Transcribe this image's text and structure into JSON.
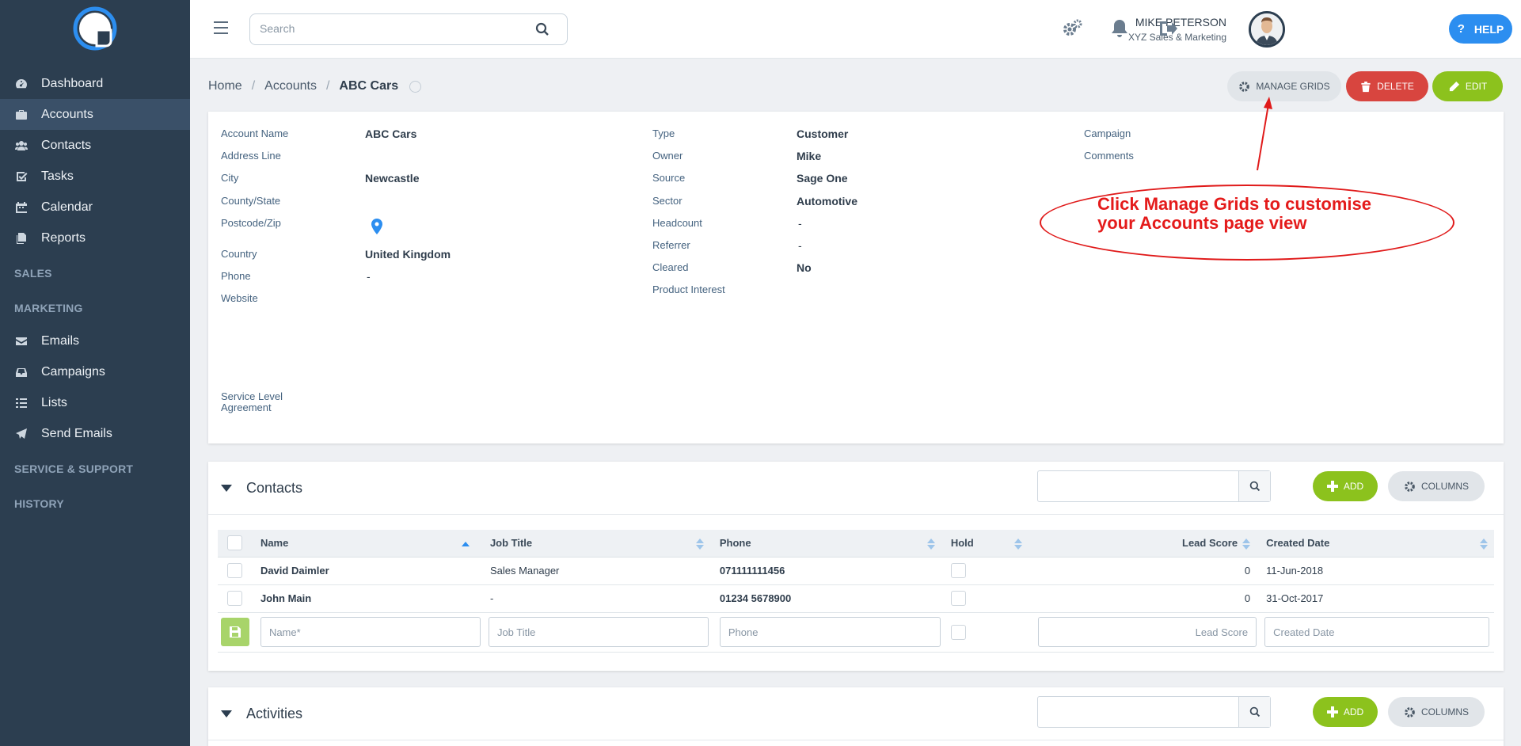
{
  "sidebar": {
    "items": [
      {
        "label": "Dashboard",
        "icon": "dashboard-icon"
      },
      {
        "label": "Accounts",
        "icon": "briefcase-icon",
        "active": true
      },
      {
        "label": "Contacts",
        "icon": "users-icon"
      },
      {
        "label": "Tasks",
        "icon": "check-square-icon"
      },
      {
        "label": "Calendar",
        "icon": "calendar-icon"
      },
      {
        "label": "Reports",
        "icon": "copy-icon"
      }
    ],
    "section_sales": "SALES",
    "section_marketing": "MARKETING",
    "marketing_items": [
      {
        "label": "Emails",
        "icon": "envelope-icon"
      },
      {
        "label": "Campaigns",
        "icon": "inbox-icon"
      },
      {
        "label": "Lists",
        "icon": "list-icon"
      },
      {
        "label": "Send Emails",
        "icon": "paper-plane-icon"
      }
    ],
    "section_service": "SERVICE & SUPPORT",
    "section_history": "HISTORY"
  },
  "header": {
    "search_placeholder": "Search",
    "user_name": "MIKE PETERSON",
    "company": "XYZ Sales & Marketing",
    "help_label": "HELP"
  },
  "breadcrumb": {
    "home": "Home",
    "accounts": "Accounts",
    "current": "ABC Cars"
  },
  "actions": {
    "manage_grids": "MANAGE GRIDS",
    "delete": "DELETE",
    "edit": "EDIT"
  },
  "details": {
    "col1": [
      {
        "label": "Account Name",
        "value": "ABC Cars"
      },
      {
        "label": "Address Line",
        "value": ""
      },
      {
        "label": "City",
        "value": "Newcastle"
      },
      {
        "label": "County/State",
        "value": ""
      },
      {
        "label": "Postcode/Zip",
        "value": ""
      },
      {
        "label": "Country",
        "value": "United Kingdom"
      },
      {
        "label": "Phone",
        "value": "-"
      },
      {
        "label": "Website",
        "value": ""
      }
    ],
    "sla_label": "Service Level Agreement",
    "col2": [
      {
        "label": "Type",
        "value": "Customer"
      },
      {
        "label": "Owner",
        "value": "Mike"
      },
      {
        "label": "Source",
        "value": "Sage One"
      },
      {
        "label": "Sector",
        "value": "Automotive"
      },
      {
        "label": "Headcount",
        "value": "-"
      },
      {
        "label": "Referrer",
        "value": "-"
      },
      {
        "label": "Cleared",
        "value": "No"
      },
      {
        "label": "Product Interest",
        "value": ""
      }
    ],
    "col3": [
      {
        "label": "Campaign",
        "value": ""
      },
      {
        "label": "Comments",
        "value": ""
      }
    ]
  },
  "annotation": {
    "line1": "Click Manage Grids to customise",
    "line2": "your Accounts page view"
  },
  "contacts": {
    "title": "Contacts",
    "add_label": "ADD",
    "columns_label": "COLUMNS",
    "headers": [
      "Name",
      "Job Title",
      "Phone",
      "Hold",
      "Lead Score",
      "Created Date"
    ],
    "rows": [
      {
        "name": "David Daimler",
        "job_title": "Sales Manager",
        "phone": "071111111456",
        "lead_score": "0",
        "created": "11-Jun-2018"
      },
      {
        "name": "John Main",
        "job_title": "-",
        "phone": "01234 5678900",
        "lead_score": "0",
        "created": "31-Oct-2017"
      }
    ],
    "new_row": {
      "name": "Name*",
      "job_title": "Job Title",
      "phone": "Phone",
      "lead_score": "Lead Score",
      "created": "Created Date"
    }
  },
  "activities": {
    "title": "Activities",
    "add_label": "ADD",
    "columns_label": "COLUMNS"
  },
  "colors": {
    "sidebar": "#2c3e50",
    "accent": "#2c8ef0",
    "green": "#8cc21d",
    "red": "#d8453f",
    "annotation": "#e41b1b"
  }
}
